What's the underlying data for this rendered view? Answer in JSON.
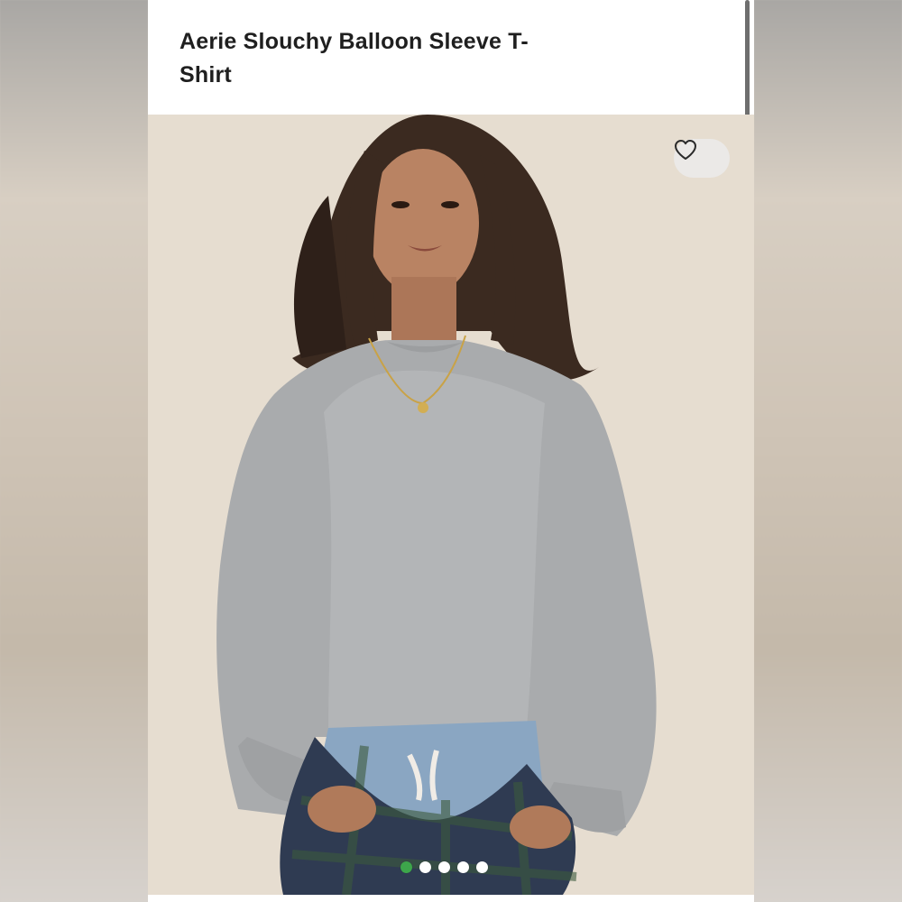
{
  "product": {
    "title": "Aerie Slouchy Balloon Sleeve T-Shirt"
  },
  "gallery": {
    "image_alt": "Model wearing grey slouchy balloon sleeve t-shirt",
    "total_images": 5,
    "active_index": 0,
    "active_dot_color": "#3da64b"
  },
  "actions": {
    "favorite_icon": "heart-outline-icon"
  }
}
